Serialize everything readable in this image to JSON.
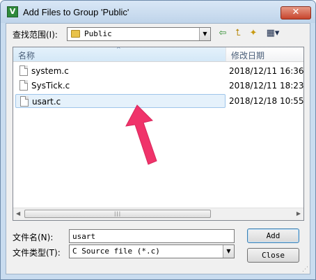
{
  "window": {
    "title": "Add Files to Group 'Public'",
    "app_icon_letter": "V",
    "close_glyph": "✕"
  },
  "look_in": {
    "label": "查找范围(I):",
    "value": "Public",
    "dropdown_glyph": "▼"
  },
  "toolbar": {
    "back_glyph": "⇦",
    "up_glyph": "⮤",
    "new_folder_glyph": "✦",
    "view_menu_glyph": "▦▾"
  },
  "file_list": {
    "columns": {
      "name": "名称",
      "date": "修改日期"
    },
    "sort_glyph": "^",
    "items": [
      {
        "name": "system.c",
        "date": "2018/12/11 16:36",
        "selected": false
      },
      {
        "name": "SysTick.c",
        "date": "2018/12/11 18:23",
        "selected": false
      },
      {
        "name": "usart.c",
        "date": "2018/12/18 10:55",
        "selected": true
      }
    ],
    "scroll_left_glyph": "◀",
    "scroll_right_glyph": "▶",
    "scroll_grip_glyph": "|||"
  },
  "file_name": {
    "label": "文件名(N):",
    "value": "usart"
  },
  "file_type": {
    "label": "文件类型(T):",
    "value": "C Source file (*.c)",
    "dropdown_glyph": "▼"
  },
  "buttons": {
    "add": "Add",
    "close": "Close"
  },
  "colors": {
    "annotation_arrow": "#f0336a",
    "selection": "#e5f1fb",
    "title_bar": "#c9dcef"
  }
}
